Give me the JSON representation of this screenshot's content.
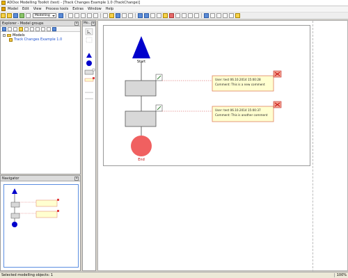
{
  "window": {
    "title": "ADOxx Modelling Toolkit (test) - [Track Changes Example 1.0 (TrackChange)]"
  },
  "menu": {
    "items": [
      "Model",
      "Edit",
      "View",
      "Process tools",
      "Extras",
      "Window",
      "Help"
    ]
  },
  "toolbar": {
    "mode_value": "Modelling"
  },
  "explorer": {
    "title": "Explorer - Model groups",
    "tree": {
      "root": "Models",
      "model": "Track Changes Example 1.0"
    }
  },
  "palette": {
    "title": "Mo..."
  },
  "navigator": {
    "title": "Navigator"
  },
  "diagram": {
    "start_label": "Start",
    "end_label": "End",
    "comments": [
      {
        "line1": "User: test  06.10.2014 15:00:28",
        "line2": "Comment: This is a new comment"
      },
      {
        "line1": "User: test  06.10.2014 15:00:37",
        "line2": "Comment: This is another comment"
      }
    ],
    "colors": {
      "start": "#0000cc",
      "end": "#f06060",
      "activity": "#d8d8d8",
      "comment_fill": "#ffffd0",
      "comment_border": "#e08060",
      "link": "#d04040"
    }
  },
  "status": {
    "text": "Selected modelling objects: 1",
    "zoom": "100%"
  }
}
